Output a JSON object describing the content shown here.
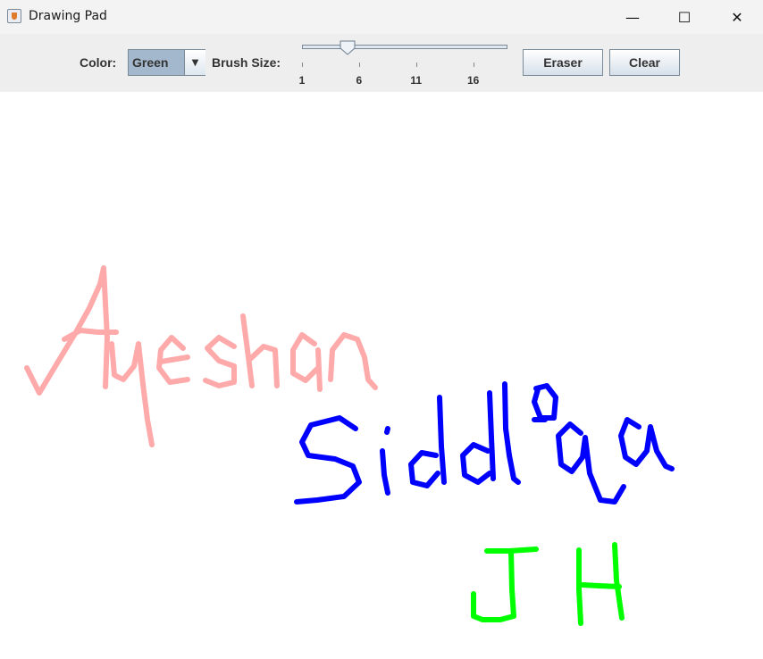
{
  "window": {
    "title": "Drawing Pad",
    "controls": {
      "minimize": "—",
      "maximize": "☐",
      "close": "✕"
    }
  },
  "toolbar": {
    "color_label": "Color:",
    "color_value": "Green",
    "color_arrow": "▼",
    "brush_label": "Brush Size:",
    "brush_min": 1,
    "brush_max": 19,
    "brush_value": 5,
    "brush_ticks": [
      "1",
      "6",
      "11",
      "16"
    ],
    "eraser_label": "Eraser",
    "clear_label": "Clear"
  },
  "canvas": {
    "strokes": [
      {
        "name": "ayesha-signature",
        "color": "#ffaaaa"
      },
      {
        "name": "siddiqa-signature",
        "color": "#0000ff"
      },
      {
        "name": "jh-initials",
        "color": "#00ff00"
      }
    ]
  }
}
